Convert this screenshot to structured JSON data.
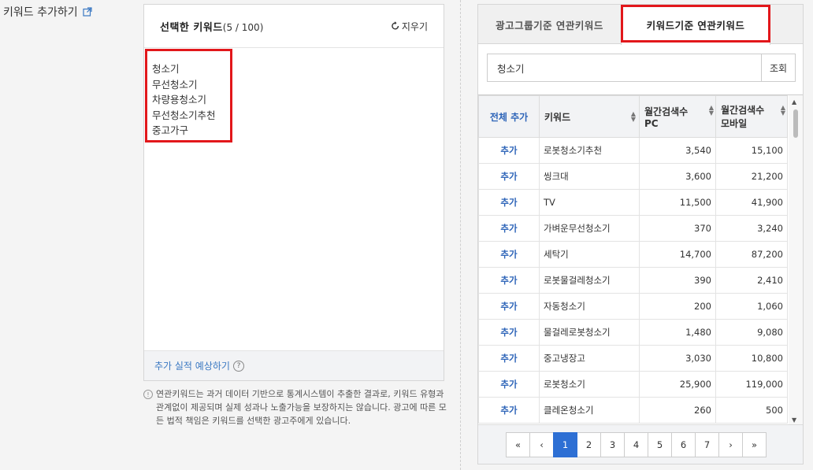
{
  "page_label": "키워드 추가하기",
  "selected_panel": {
    "title": "선택한 키워드",
    "count": "(5 / 100)",
    "clear_label": "지우기",
    "keywords": [
      "청소기",
      "무선청소기",
      "차량용청소기",
      "무선청소기추천",
      "중고가구"
    ],
    "simulate_label": "추가 실적 예상하기"
  },
  "notice": "연관키워드는 과거 데이터 기반으로 통계시스템이 추출한 결과로, 키워드 유형과 관계없이 제공되며 실제 성과나 노출가능을 보장하지는 않습니다. 광고에 따른 모든 법적 책임은 키워드를 선택한 광고주에게 있습니다.",
  "related_panel": {
    "tabs": [
      "광고그룹기준 연관키워드",
      "키워드기준 연관키워드"
    ],
    "active_tab": 1,
    "search_value": "청소기",
    "search_button": "조회",
    "columns": {
      "add_all": "전체 추가",
      "keyword": "키워드",
      "pc_line1": "월간검색수",
      "pc_line2": "PC",
      "mobile_line1": "월간검색수",
      "mobile_line2": "모바일"
    },
    "rows": [
      {
        "action": "추가",
        "keyword": "로봇청소기추천",
        "pc": "3,540",
        "mobile": "15,100"
      },
      {
        "action": "추가",
        "keyword": "씽크대",
        "pc": "3,600",
        "mobile": "21,200"
      },
      {
        "action": "추가",
        "keyword": "TV",
        "pc": "11,500",
        "mobile": "41,900"
      },
      {
        "action": "추가",
        "keyword": "가벼운무선청소기",
        "pc": "370",
        "mobile": "3,240"
      },
      {
        "action": "추가",
        "keyword": "세탁기",
        "pc": "14,700",
        "mobile": "87,200"
      },
      {
        "action": "추가",
        "keyword": "로봇물걸레청소기",
        "pc": "390",
        "mobile": "2,410"
      },
      {
        "action": "추가",
        "keyword": "자동청소기",
        "pc": "200",
        "mobile": "1,060"
      },
      {
        "action": "추가",
        "keyword": "물걸레로봇청소기",
        "pc": "1,480",
        "mobile": "9,080"
      },
      {
        "action": "추가",
        "keyword": "중고냉장고",
        "pc": "3,030",
        "mobile": "10,800"
      },
      {
        "action": "추가",
        "keyword": "로봇청소기",
        "pc": "25,900",
        "mobile": "119,000"
      },
      {
        "action": "추가",
        "keyword": "클레온청소기",
        "pc": "260",
        "mobile": "500"
      }
    ],
    "pagination": {
      "first": "«",
      "prev": "‹",
      "next": "›",
      "last": "»",
      "pages": [
        "1",
        "2",
        "3",
        "4",
        "5",
        "6",
        "7"
      ],
      "current": "1"
    }
  },
  "highlight_color": "#e2171b",
  "accent_color": "#2d6fd4"
}
